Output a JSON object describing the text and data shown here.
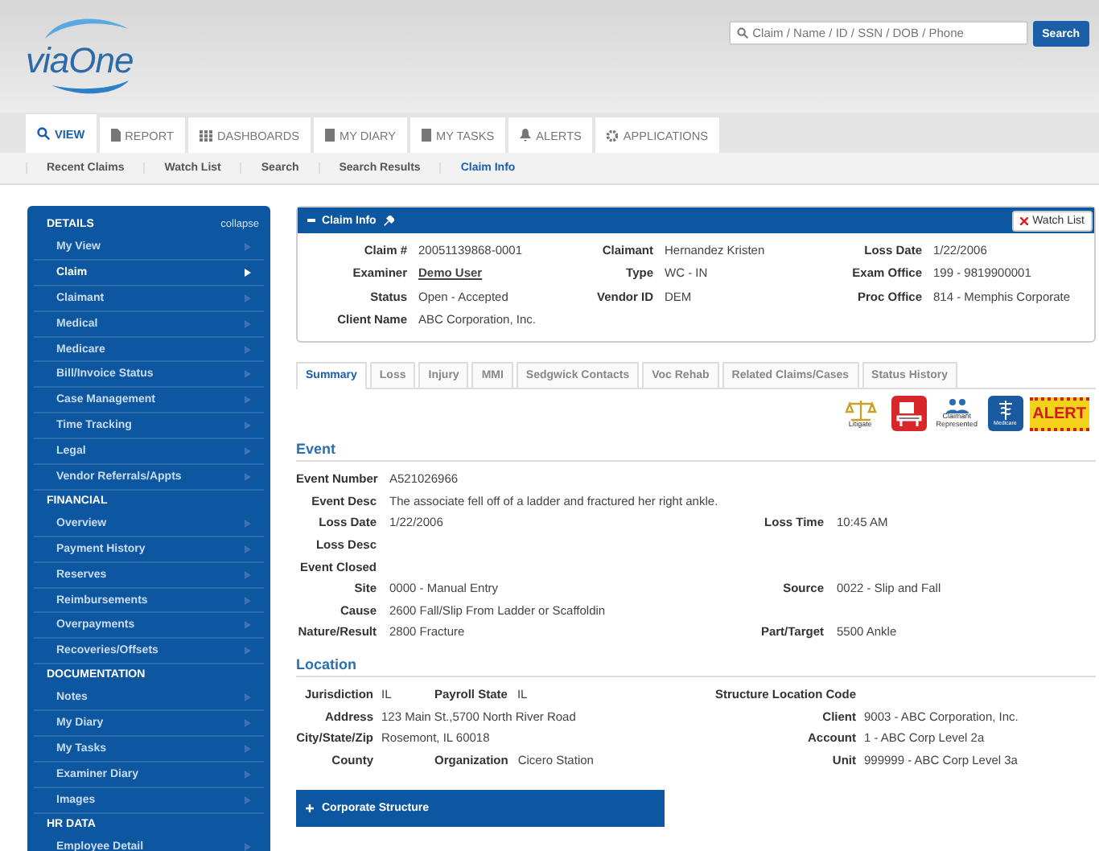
{
  "header": {
    "logo": "viaOne",
    "search_placeholder": "Claim / Name / ID / SSN / DOB / Phone",
    "search_button": "Search"
  },
  "tabs": [
    {
      "label": "VIEW",
      "kind": "view",
      "selected": true
    },
    {
      "label": "REPORT",
      "kind": "report",
      "selected": false
    },
    {
      "label": "DASHBOARDS",
      "kind": "dashboards",
      "selected": false
    },
    {
      "label": "MY DIARY",
      "kind": "diary",
      "selected": false
    },
    {
      "label": "MY TASKS",
      "kind": "tasks",
      "selected": false
    },
    {
      "label": "ALERTS",
      "kind": "alerts",
      "selected": false
    },
    {
      "label": "APPLICATIONS",
      "kind": "applications",
      "selected": false
    }
  ],
  "subnav": [
    {
      "label": "Recent Claims",
      "selected": false
    },
    {
      "label": "Watch List",
      "selected": false
    },
    {
      "label": "Search",
      "selected": false
    },
    {
      "label": "Search Results",
      "selected": false
    },
    {
      "label": "Claim Info",
      "selected": true
    }
  ],
  "sidebar": {
    "collapse": "collapse",
    "sections": [
      {
        "title": "DETAILS",
        "items": [
          {
            "label": "My View",
            "selected": false
          },
          {
            "label": "Claim",
            "selected": true
          },
          {
            "label": "Claimant",
            "selected": false
          },
          {
            "label": "Medical",
            "selected": false
          },
          {
            "label": "Medicare",
            "selected": false
          },
          {
            "label": "Bill/Invoice Status",
            "selected": false
          },
          {
            "label": "Case Management",
            "selected": false
          },
          {
            "label": "Time Tracking",
            "selected": false
          },
          {
            "label": "Legal",
            "selected": false
          },
          {
            "label": "Vendor Referrals/Appts",
            "selected": false
          }
        ]
      },
      {
        "title": "FINANCIAL",
        "items": [
          {
            "label": "Overview",
            "selected": false
          },
          {
            "label": "Payment History",
            "selected": false
          },
          {
            "label": "Reserves",
            "selected": false
          },
          {
            "label": "Reimbursements",
            "selected": false
          },
          {
            "label": "Overpayments",
            "selected": false
          },
          {
            "label": "Recoveries/Offsets",
            "selected": false
          }
        ]
      },
      {
        "title": "DOCUMENTATION",
        "items": [
          {
            "label": "Notes",
            "selected": false
          },
          {
            "label": "My Diary",
            "selected": false
          },
          {
            "label": "My Tasks",
            "selected": false
          },
          {
            "label": "Examiner Diary",
            "selected": false
          },
          {
            "label": "Images",
            "selected": false
          }
        ]
      },
      {
        "title": "HR DATA",
        "items": [
          {
            "label": "Employee Detail",
            "selected": false
          }
        ]
      }
    ]
  },
  "claim_info": {
    "title": "Claim Info",
    "watch_list_button": "Watch List",
    "rows": [
      [
        {
          "label": "Claim #",
          "value": "20051139868-0001",
          "kind": "text"
        },
        {
          "label": "Claimant",
          "value": "Hernandez Kristen",
          "kind": "text"
        },
        {
          "label": "Loss Date",
          "value": "1/22/2006",
          "kind": "text"
        }
      ],
      [
        {
          "label": "Examiner",
          "value": "Demo User",
          "kind": "link"
        },
        {
          "label": "Type",
          "value": "WC - IN",
          "kind": "text"
        },
        {
          "label": "Exam Office",
          "value": "199 - 9819900001",
          "kind": "text"
        }
      ],
      [
        {
          "label": "Status",
          "value": "Open - Accepted",
          "kind": "text"
        },
        {
          "label": "Vendor ID",
          "value": "DEM",
          "kind": "text"
        },
        {
          "label": "Proc Office",
          "value": "814 - Memphis Corporate",
          "kind": "text"
        }
      ],
      [
        {
          "label": "Client Name",
          "value": "ABC Corporation, Inc.",
          "kind": "text"
        }
      ]
    ]
  },
  "detail_tabs": [
    {
      "label": "Summary",
      "selected": true
    },
    {
      "label": "Loss",
      "selected": false
    },
    {
      "label": "Injury",
      "selected": false
    },
    {
      "label": "MMI",
      "selected": false
    },
    {
      "label": "Sedgwick Contacts",
      "selected": false
    },
    {
      "label": "Voc Rehab",
      "selected": false
    },
    {
      "label": "Related Claims/Cases",
      "selected": false
    },
    {
      "label": "Status History",
      "selected": false
    }
  ],
  "flags": [
    {
      "kind": "scales",
      "caption": "Litigate"
    },
    {
      "kind": "desk"
    },
    {
      "kind": "people",
      "caption": "Claimant Represented"
    },
    {
      "kind": "medical",
      "caption": "Medicare"
    },
    {
      "kind": "alert",
      "caption": "ALERT"
    }
  ],
  "event": {
    "title": "Event",
    "rows": [
      {
        "left": {
          "label": "Event Number",
          "value": "A521026966"
        }
      },
      {
        "left": {
          "label": "Event Desc",
          "value": "The associate fell off of a ladder and fractured her right ankle."
        }
      },
      {
        "left": {
          "label": "Loss Date",
          "value": "1/22/2006"
        },
        "right": {
          "label": "Loss Time",
          "value": "10:45 AM"
        }
      },
      {
        "left": {
          "label": "Loss Desc"
        }
      },
      {
        "left": {
          "label": "Event Closed"
        }
      },
      {
        "left": {
          "label": "Site",
          "value": "0000 - Manual Entry"
        },
        "right": {
          "label": "Source",
          "value": "0022 - Slip and Fall"
        }
      },
      {
        "left": {
          "label": "Cause",
          "value": "2600 Fall/Slip From Ladder or Scaffoldin"
        }
      },
      {
        "left": {
          "label": "Nature/Result",
          "value": "2800 Fracture"
        },
        "right": {
          "label": "Part/Target",
          "value": "5500 Ankle"
        }
      }
    ]
  },
  "location": {
    "title": "Location",
    "rows": [
      {
        "left": [
          {
            "label": "Jurisdiction",
            "value": "IL"
          },
          {
            "label": "Payroll State",
            "value": "IL"
          }
        ],
        "right": {
          "label": "Structure Location Code"
        }
      },
      {
        "left": [
          {
            "label": "Address",
            "value": "123 Main St.,5700 North River Road"
          }
        ],
        "right": {
          "label": "Client",
          "value": "9003 - ABC Corporation, Inc."
        }
      },
      {
        "left": [
          {
            "label": "City/State/Zip",
            "value": "Rosemont, IL 60018"
          }
        ],
        "right": {
          "label": "Account",
          "value": "1 - ABC Corp Level 2a"
        }
      },
      {
        "left": [
          {
            "label": "County"
          },
          {
            "label": "Organization",
            "value": "Cicero Station"
          }
        ],
        "right": {
          "label": "Unit",
          "value": "999999 - ABC Corp Level 3a"
        }
      }
    ]
  },
  "corporate_structure": {
    "label": "Corporate Structure",
    "expanded": false
  }
}
